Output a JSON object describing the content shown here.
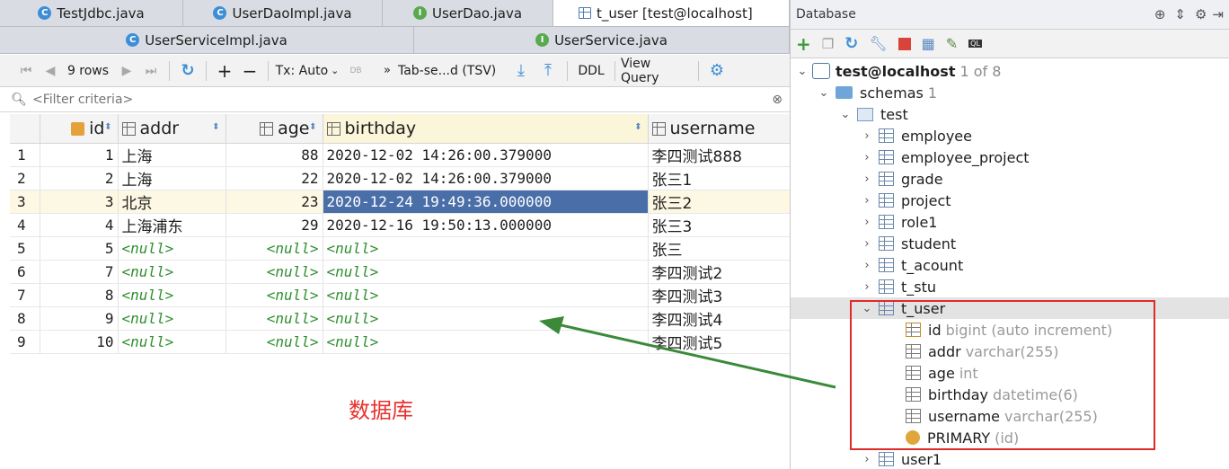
{
  "tabs_row1": [
    {
      "label": "TestJdbc.java",
      "icon": "class-icon"
    },
    {
      "label": "UserDaoImpl.java",
      "icon": "class-icon"
    },
    {
      "label": "UserDao.java",
      "icon": "interface-icon"
    },
    {
      "label": "t_user [test@localhost]",
      "icon": "table-icon",
      "active": true
    }
  ],
  "tabs_row2": [
    {
      "label": "UserServiceImpl.java",
      "icon": "class-icon"
    },
    {
      "label": "UserService.java",
      "icon": "interface-icon"
    }
  ],
  "toolbar": {
    "rows_label": "9 rows",
    "tx_label": "Tx: Auto",
    "tx_badge": "DB",
    "format_label": "Tab-se...d (TSV)",
    "ddl_label": "DDL",
    "view_query_label": "View Query"
  },
  "filter": {
    "placeholder": "<Filter criteria>"
  },
  "grid": {
    "columns": [
      "id",
      "addr",
      "age",
      "birthday",
      "username"
    ],
    "rows": [
      {
        "n": "1",
        "id": "1",
        "addr": "上海",
        "age": "88",
        "birthday": "2020-12-02 14:26:00.379000",
        "username": "李四测试888"
      },
      {
        "n": "2",
        "id": "2",
        "addr": "上海",
        "age": "22",
        "birthday": "2020-12-02 14:26:00.379000",
        "username": "张三1"
      },
      {
        "n": "3",
        "id": "3",
        "addr": "北京",
        "age": "23",
        "birthday": "2020-12-24 19:49:36.000000",
        "username": "张三2"
      },
      {
        "n": "4",
        "id": "4",
        "addr": "上海浦东",
        "age": "29",
        "birthday": "2020-12-16 19:50:13.000000",
        "username": "张三3"
      },
      {
        "n": "5",
        "id": "5",
        "addr": "<null>",
        "age": "<null>",
        "birthday": "<null>",
        "username": "张三"
      },
      {
        "n": "6",
        "id": "7",
        "addr": "<null>",
        "age": "<null>",
        "birthday": "<null>",
        "username": "李四测试2"
      },
      {
        "n": "7",
        "id": "8",
        "addr": "<null>",
        "age": "<null>",
        "birthday": "<null>",
        "username": "李四测试3"
      },
      {
        "n": "8",
        "id": "9",
        "addr": "<null>",
        "age": "<null>",
        "birthday": "<null>",
        "username": "李四测试4"
      },
      {
        "n": "9",
        "id": "10",
        "addr": "<null>",
        "age": "<null>",
        "birthday": "<null>",
        "username": "李四测试5"
      }
    ]
  },
  "annotation": {
    "text": "数据库",
    "color": "#e8322f"
  },
  "db_panel": {
    "title": "Database",
    "connection": "test@localhost",
    "connection_meta": "1 of 8",
    "schemas_label": "schemas",
    "schemas_count": "1",
    "schema_name": "test",
    "tables": [
      "employee",
      "employee_project",
      "grade",
      "project",
      "role1",
      "student",
      "t_acount",
      "t_stu",
      "t_user",
      "user1"
    ],
    "t_user_columns": [
      {
        "name": "id",
        "type": "bigint (auto increment)"
      },
      {
        "name": "addr",
        "type": "varchar(255)"
      },
      {
        "name": "age",
        "type": "int"
      },
      {
        "name": "birthday",
        "type": "datetime(6)"
      },
      {
        "name": "username",
        "type": "varchar(255)"
      }
    ],
    "primary_key": {
      "name": "PRIMARY",
      "cols": "(id)"
    }
  }
}
